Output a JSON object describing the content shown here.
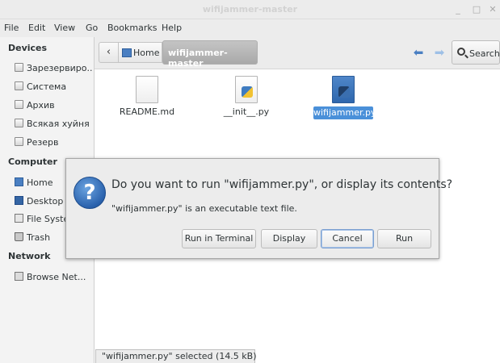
{
  "window": {
    "title": "wifijammer-master",
    "controls": {
      "minimize": "_",
      "maximize": "□",
      "close": "✕"
    }
  },
  "menu": [
    "File",
    "Edit",
    "View",
    "Go",
    "Bookmarks",
    "Help"
  ],
  "sidebar": {
    "devices_header": "Devices",
    "devices": [
      "Зарезервиро...",
      "Система",
      "Архив",
      "Всякая хуйня",
      "Резерв"
    ],
    "computer_header": "Computer",
    "computer": [
      "Home",
      "Desktop",
      "File System",
      "Trash"
    ],
    "network_header": "Network",
    "network": [
      "Browse Net..."
    ]
  },
  "toolbar": {
    "back_glyph": "‹",
    "crumb_home": "Home",
    "crumb_current": "wifijammer-master",
    "nav_back_glyph": "⬅",
    "nav_forward_glyph": "➡",
    "search_label": "Search"
  },
  "files": [
    {
      "name": "README.md",
      "icon": "text-file-icon",
      "selected": false
    },
    {
      "name": "__init__.py",
      "icon": "python-file-icon",
      "selected": false
    },
    {
      "name": "wifijammer.py",
      "icon": "python-executable-icon",
      "selected": true
    }
  ],
  "status": "\"wifijammer.py\" selected (14.5 kB)",
  "dialog": {
    "icon_glyph": "?",
    "title": "Do you want to run \"wifijammer.py\", or display its contents?",
    "subtitle": "\"wifijammer.py\" is an executable text file.",
    "buttons": {
      "run_in_terminal": "Run in Terminal",
      "display": "Display",
      "cancel": "Cancel",
      "run": "Run"
    }
  },
  "colors": {
    "selection": "#4a90d9",
    "dialog_icon": "#2a62ad",
    "breadcrumb_active": "#a9a9a9"
  }
}
